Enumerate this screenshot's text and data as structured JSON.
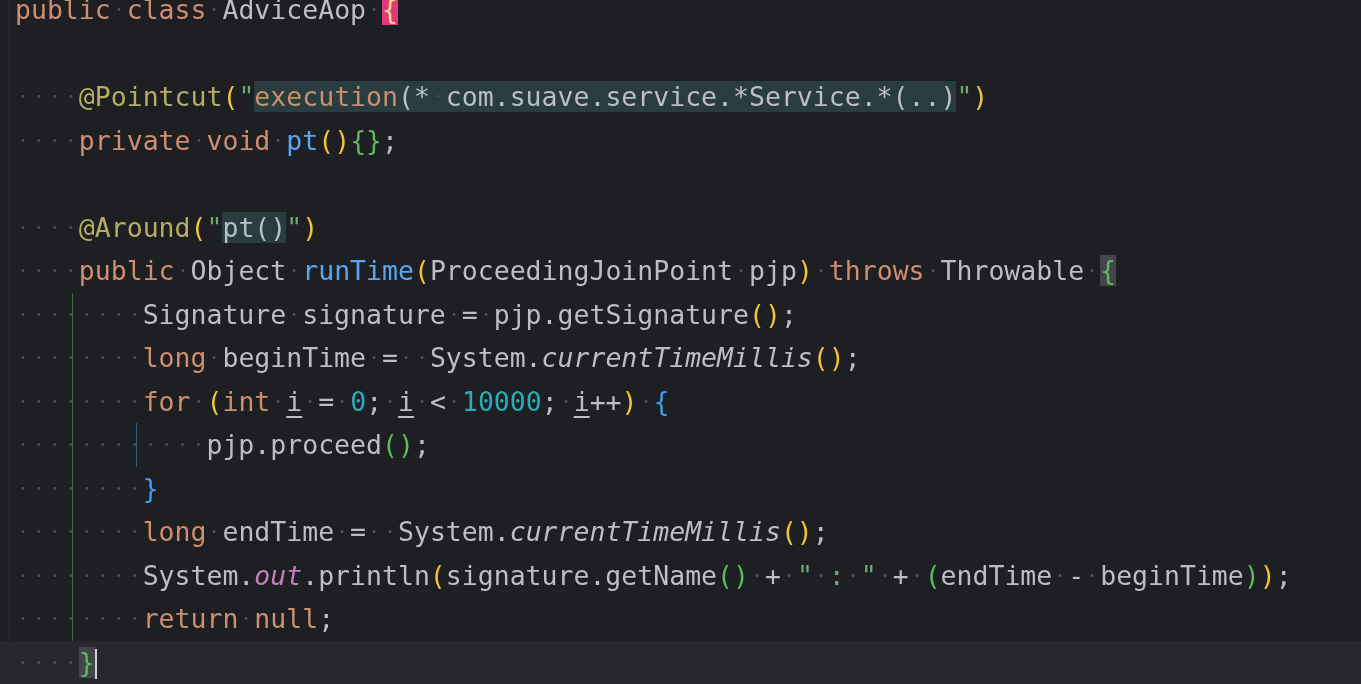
{
  "editor": {
    "lines": [
      {
        "current": false,
        "tokens": [
          {
            "kind": "keyword",
            "text": "public "
          },
          {
            "kind": "keyword",
            "text": "class "
          },
          {
            "kind": "plain",
            "text": "AdviceAop "
          },
          {
            "kind": "bracket-unmatched",
            "text": "{"
          }
        ]
      },
      {
        "current": false
      },
      {
        "current": false,
        "tokens": [
          {
            "kind": "annotation",
            "text": "    @Pointcut"
          },
          {
            "kind": "bracket-a",
            "text": "("
          },
          {
            "kind": "string",
            "text": "\""
          },
          {
            "kind": "injection",
            "tokens": [
              {
                "kind": "keyword",
                "text": "execution"
              },
              {
                "kind": "plain",
                "text": "(* com.suave.service.*Service.*(..)"
              }
            ]
          },
          {
            "kind": "string",
            "text": "\""
          },
          {
            "kind": "bracket-a",
            "text": ")"
          }
        ]
      },
      {
        "current": false,
        "tokens": [
          {
            "kind": "keyword",
            "text": "    private "
          },
          {
            "kind": "keyword",
            "text": "void "
          },
          {
            "kind": "method",
            "text": "pt"
          },
          {
            "kind": "bracket-a",
            "text": "()"
          },
          {
            "kind": "bracket-b",
            "text": "{}"
          },
          {
            "kind": "plain",
            "text": ";"
          }
        ]
      },
      {
        "current": false
      },
      {
        "current": false,
        "tokens": [
          {
            "kind": "annotation",
            "text": "    @Around"
          },
          {
            "kind": "bracket-a",
            "text": "("
          },
          {
            "kind": "string",
            "text": "\""
          },
          {
            "kind": "injection",
            "tokens": [
              {
                "kind": "plain",
                "text": "pt()"
              }
            ]
          },
          {
            "kind": "string",
            "text": "\""
          },
          {
            "kind": "bracket-a",
            "text": ")"
          }
        ]
      },
      {
        "current": false,
        "tokens": [
          {
            "kind": "keyword",
            "text": "    public "
          },
          {
            "kind": "plain",
            "text": "Object "
          },
          {
            "kind": "method",
            "text": "runTime"
          },
          {
            "kind": "bracket-a",
            "text": "("
          },
          {
            "kind": "plain",
            "text": "ProceedingJoinPoint pjp"
          },
          {
            "kind": "bracket-a",
            "text": ") "
          },
          {
            "kind": "keyword",
            "text": "throws "
          },
          {
            "kind": "plain",
            "text": "Throwable "
          },
          {
            "kind": "bracket-b-matched",
            "text": "{"
          }
        ]
      },
      {
        "current": false,
        "tokens": [
          {
            "kind": "plain",
            "text": "        Signature signature = pjp.getSignature"
          },
          {
            "kind": "bracket-a",
            "text": "()"
          },
          {
            "kind": "plain",
            "text": ";"
          }
        ]
      },
      {
        "current": false,
        "tokens": [
          {
            "kind": "keyword",
            "text": "        long "
          },
          {
            "kind": "plain",
            "text": "beginTime =  System."
          },
          {
            "kind": "static",
            "text": "currentTimeMillis"
          },
          {
            "kind": "bracket-a",
            "text": "()"
          },
          {
            "kind": "plain",
            "text": ";"
          }
        ]
      },
      {
        "current": false,
        "tokens": [
          {
            "kind": "keyword",
            "text": "        for "
          },
          {
            "kind": "bracket-a",
            "text": "("
          },
          {
            "kind": "keyword",
            "text": "int "
          },
          {
            "kind": "variable",
            "text": "i"
          },
          {
            "kind": "plain",
            "text": " = "
          },
          {
            "kind": "number",
            "text": "0"
          },
          {
            "kind": "plain",
            "text": "; "
          },
          {
            "kind": "variable",
            "text": "i"
          },
          {
            "kind": "plain",
            "text": " < "
          },
          {
            "kind": "number",
            "text": "10000"
          },
          {
            "kind": "plain",
            "text": "; "
          },
          {
            "kind": "variable",
            "text": "i"
          },
          {
            "kind": "plain",
            "text": "++"
          },
          {
            "kind": "bracket-a",
            "text": ") "
          },
          {
            "kind": "bracket-c",
            "text": "{"
          }
        ]
      },
      {
        "current": false,
        "tokens": [
          {
            "kind": "plain",
            "text": "            pjp.proceed"
          },
          {
            "kind": "bracket-b",
            "text": "()"
          },
          {
            "kind": "plain",
            "text": ";"
          }
        ]
      },
      {
        "current": false,
        "tokens": [
          {
            "kind": "bracket-c",
            "text": "        }"
          }
        ]
      },
      {
        "current": false,
        "tokens": [
          {
            "kind": "keyword",
            "text": "        long "
          },
          {
            "kind": "plain",
            "text": "endTime =  System."
          },
          {
            "kind": "static",
            "text": "currentTimeMillis"
          },
          {
            "kind": "bracket-a",
            "text": "()"
          },
          {
            "kind": "plain",
            "text": ";"
          }
        ]
      },
      {
        "current": false,
        "tokens": [
          {
            "kind": "plain",
            "text": "        System."
          },
          {
            "kind": "field",
            "text": "out"
          },
          {
            "kind": "plain",
            "text": ".println"
          },
          {
            "kind": "bracket-a",
            "text": "("
          },
          {
            "kind": "plain",
            "text": "signature.getName"
          },
          {
            "kind": "bracket-b",
            "text": "()"
          },
          {
            "kind": "plain",
            "text": " + "
          },
          {
            "kind": "string",
            "text": "\" : \""
          },
          {
            "kind": "plain",
            "text": " + "
          },
          {
            "kind": "bracket-b",
            "text": "("
          },
          {
            "kind": "plain",
            "text": "endTime - beginTime"
          },
          {
            "kind": "bracket-b",
            "text": ")"
          },
          {
            "kind": "bracket-a",
            "text": ")"
          },
          {
            "kind": "plain",
            "text": ";"
          }
        ]
      },
      {
        "current": false,
        "tokens": [
          {
            "kind": "keyword",
            "text": "        return "
          },
          {
            "kind": "keyword",
            "text": "null"
          },
          {
            "kind": "plain",
            "text": ";"
          }
        ]
      },
      {
        "current": true,
        "tokens": [
          {
            "kind": "bracket-b-matched",
            "text": "    }"
          }
        ]
      }
    ]
  }
}
